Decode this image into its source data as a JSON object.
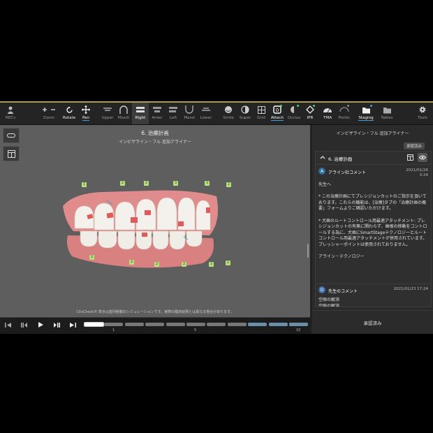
{
  "toolbar": {
    "items": [
      {
        "label": "RECs",
        "icon": "person-icon"
      },
      {
        "label": "Zoom",
        "icon": "zoom-icon"
      },
      {
        "label": "Rotate",
        "icon": "rotate-icon"
      },
      {
        "label": "Pan",
        "icon": "pan-icon"
      },
      {
        "label": "Upper",
        "icon": "upper-jaw-icon"
      },
      {
        "label": "Maxill",
        "icon": "maxillary-icon"
      },
      {
        "label": "Right",
        "icon": "right-view-icon"
      },
      {
        "label": "Anter",
        "icon": "anterior-view-icon"
      },
      {
        "label": "Left",
        "icon": "left-view-icon"
      },
      {
        "label": "Mand",
        "icon": "mandibular-icon"
      },
      {
        "label": "Lower",
        "icon": "lower-jaw-icon"
      },
      {
        "label": "Smile",
        "icon": "smile-icon"
      },
      {
        "label": "Super",
        "icon": "superimpose-icon"
      },
      {
        "label": "Grid",
        "icon": "grid-icon"
      },
      {
        "label": "Attach",
        "icon": "attachment-icon"
      },
      {
        "label": "Occlus",
        "icon": "occlusion-icon"
      },
      {
        "label": "IPR",
        "icon": "ipr-icon"
      },
      {
        "label": "TMA",
        "icon": "tma-icon"
      },
      {
        "label": "Pontic",
        "icon": "pontic-icon"
      },
      {
        "label": "Staging",
        "icon": "staging-icon"
      },
      {
        "label": "Tables",
        "icon": "tables-icon"
      },
      {
        "label": "Tools",
        "icon": "gear-icon"
      }
    ]
  },
  "viewport": {
    "title": "6. 治療計画",
    "subtitle": "インビザライン・フル 追加アライナー",
    "disclaimer": "ClinCheck® 表示は歯列移動のシミュレーションです。実際の臨床結果とは異なる場合があります。",
    "attachment_markers_upper": [
      "1",
      "2",
      "2",
      "3",
      "3",
      "2"
    ],
    "attachment_markers_lower": [
      "2",
      "2",
      "2",
      "2",
      "2",
      "2"
    ]
  },
  "timeline": {
    "stage_labels": [
      "1",
      "5",
      "10"
    ],
    "segments": 11
  },
  "panel": {
    "title": "インビザライン・フル 追加アライナー",
    "approved_chip": "承認済み",
    "section_title": "6. 治療計画",
    "comment1": {
      "avatar": "A",
      "author": "アライン社コメント",
      "date": "2021/01/26",
      "time": "3:24",
      "body": "先生へ\n\n* この治療計画にてプレシジョンカットのご指示を頂いております。これらの機能は、[治療]タブの「治療計画の概要」フォームよりご確認いただけます。\n\n* 犬歯のルートコントロール用最適アタッチメント: プレシジョンカットの有無に関わらず、歯根の移動をコントロールする為に、犬歯にSmartStageテクノロジーとルートコントロール用最適アタッチメントが併用されています。プレッシャーポイントは使用されておりません。\n\nアライン・テクノロジー"
    },
    "comment2": {
      "avatar": "D",
      "author": "先生のコメント",
      "date": "2021/01/23 17:24",
      "body": "空隙の解消\n空隙の解消\n叢生の解"
    },
    "approve_button": "承認済み"
  },
  "colors": {
    "accent": "#3aa0e0",
    "badge": "#4cd26a",
    "gum": "#e28a8a",
    "marker": "#b8e07a"
  }
}
